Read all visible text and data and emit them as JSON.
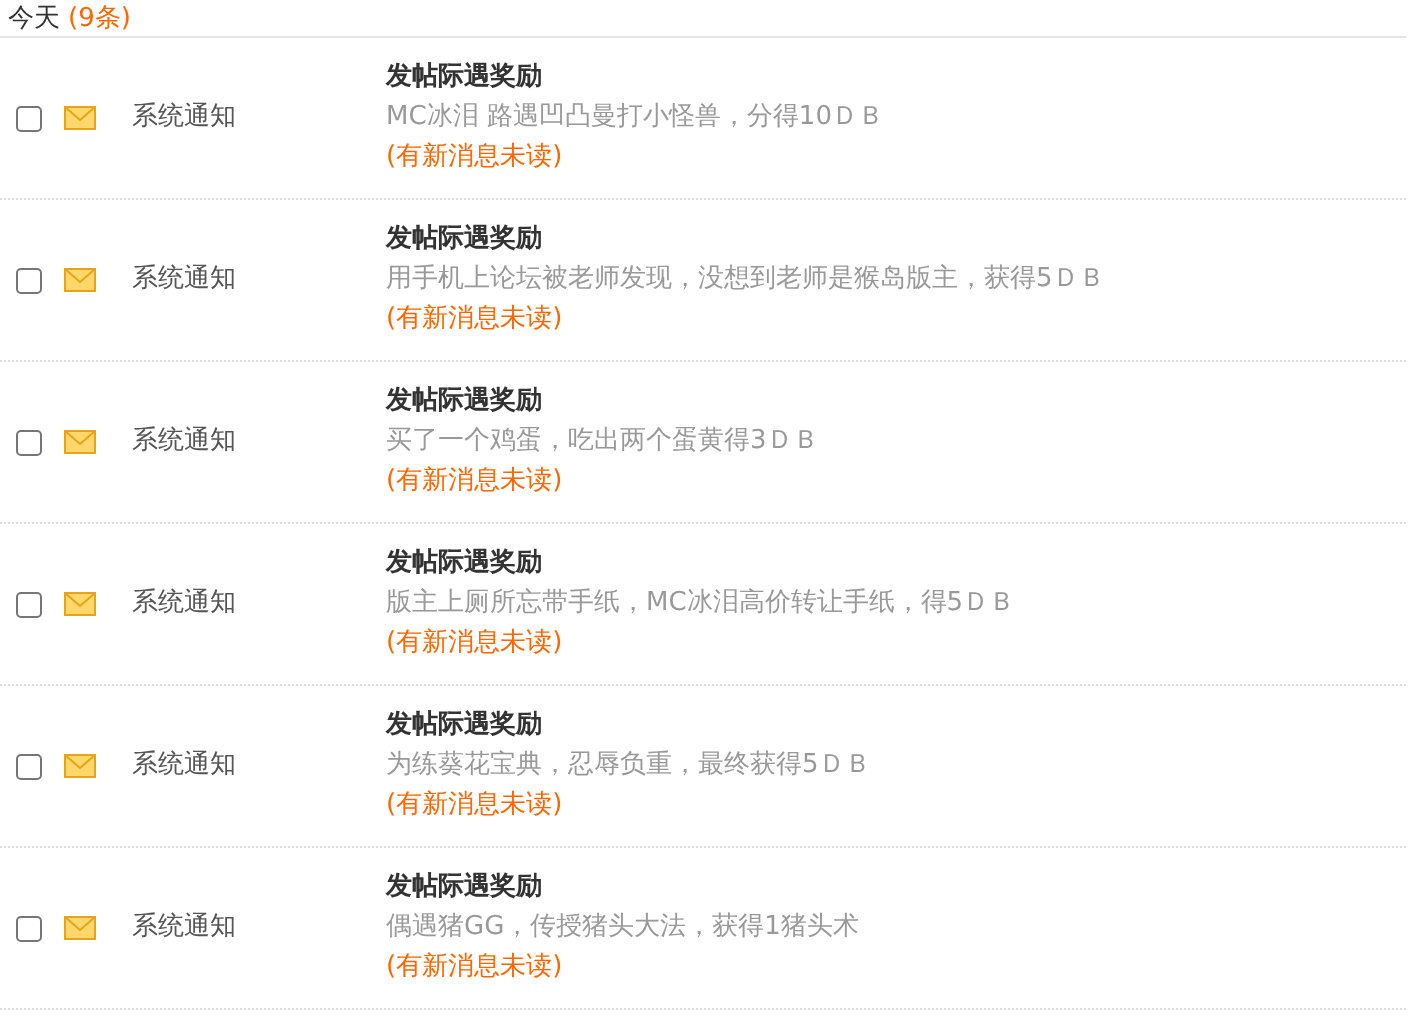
{
  "header": {
    "label": "今天",
    "count": "(9条)"
  },
  "messages": [
    {
      "checked": false,
      "unread": true,
      "sender": "系统通知",
      "title": "发帖际遇奖励",
      "body": "MC冰泪 路遇凹凸曼打小怪兽，分得10ＤＢ",
      "status": "(有新消息未读)"
    },
    {
      "checked": false,
      "unread": true,
      "sender": "系统通知",
      "title": "发帖际遇奖励",
      "body": "用手机上论坛被老师发现，没想到老师是猴岛版主，获得5ＤＢ",
      "status": "(有新消息未读)"
    },
    {
      "checked": false,
      "unread": true,
      "sender": "系统通知",
      "title": "发帖际遇奖励",
      "body": "买了一个鸡蛋，吃出两个蛋黄得3ＤＢ",
      "status": "(有新消息未读)"
    },
    {
      "checked": false,
      "unread": true,
      "sender": "系统通知",
      "title": "发帖际遇奖励",
      "body": "版主上厕所忘带手纸，MC冰泪高价转让手纸，得5ＤＢ",
      "status": "(有新消息未读)"
    },
    {
      "checked": false,
      "unread": true,
      "sender": "系统通知",
      "title": "发帖际遇奖励",
      "body": "为练葵花宝典，忍辱负重，最终获得5ＤＢ",
      "status": "(有新消息未读)"
    },
    {
      "checked": false,
      "unread": true,
      "sender": "系统通知",
      "title": "发帖际遇奖励",
      "body": "偶遇猪GG，传授猪头大法，获得1猪头术",
      "status": "(有新消息未读)"
    }
  ]
}
